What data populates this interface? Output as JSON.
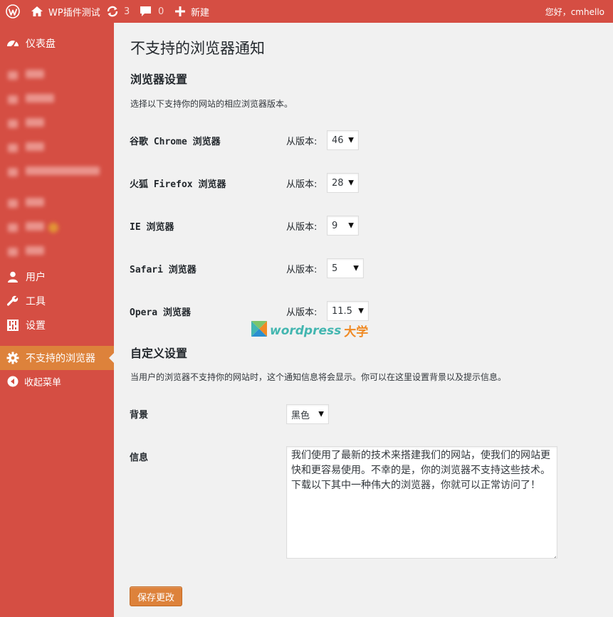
{
  "admin_bar": {
    "site_name": "WP插件测试",
    "updates_count": "3",
    "comments_count": "0",
    "new_label": "新建",
    "greeting": "您好，cmhello"
  },
  "sidebar": {
    "dashboard": "仪表盘",
    "users": "用户",
    "tools": "工具",
    "settings": "设置",
    "current": "不支持的浏览器",
    "collapse": "收起菜单"
  },
  "page": {
    "title": "不支持的浏览器通知",
    "section1_title": "浏览器设置",
    "section1_desc": "选择以下支持你的网站的相应浏览器版本。",
    "version_label": "从版本:",
    "browsers": [
      {
        "label": "谷歌 Chrome 浏览器",
        "version": "46"
      },
      {
        "label": "火狐 Firefox 浏览器",
        "version": "28"
      },
      {
        "label": "IE 浏览器",
        "version": "9"
      },
      {
        "label": "Safari 浏览器",
        "version": "5"
      },
      {
        "label": "Opera 浏览器",
        "version": "11.5"
      }
    ],
    "section2_title": "自定义设置",
    "section2_desc": "当用户的浏览器不支持你的网站时，这个通知信息将会显示。你可以在这里设置背景以及提示信息。",
    "background_label": "背景",
    "background_value": "黑色",
    "message_label": "信息",
    "message_text": "我们使用了最新的技术来搭建我们的网站，使我们的网站更快和更容易使用。不幸的是，你的浏览器不支持这些技术。下载以下其中一种伟大的浏览器，你就可以正常访问了！",
    "save_button": "保存更改"
  },
  "watermark": {
    "latin": "wordpress",
    "cn": "大学"
  },
  "colors": {
    "accent": "#d54e43",
    "current_menu": "#dd823b",
    "button": "#dd823b"
  }
}
